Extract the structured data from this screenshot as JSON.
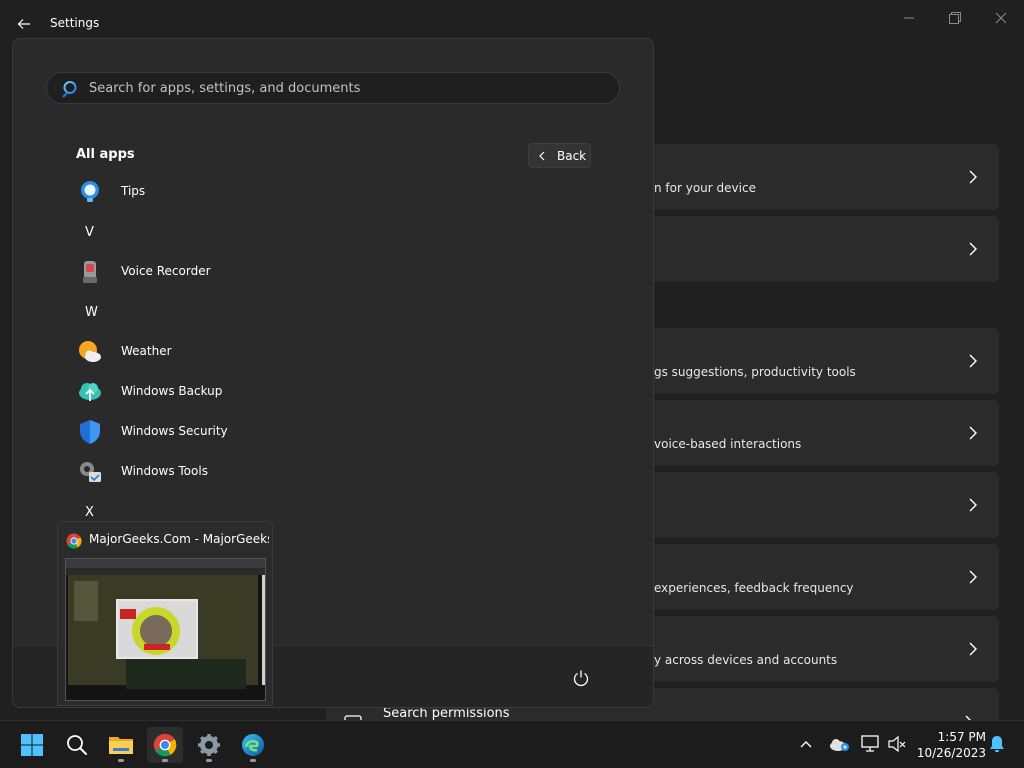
{
  "window": {
    "title": "Settings"
  },
  "settings_rows": [
    {
      "desc": "n for your device"
    },
    {
      "desc": ""
    },
    {
      "desc": "gs suggestions, productivity tools"
    },
    {
      "desc": "voice-based interactions"
    },
    {
      "desc": ""
    },
    {
      "desc": "experiences, feedback frequency"
    },
    {
      "desc": "y across devices and accounts"
    }
  ],
  "search_permissions": {
    "label": "Search permissions"
  },
  "start_menu": {
    "search": {
      "placeholder": "Search for apps, settings, and documents",
      "value": ""
    },
    "all_apps_title": "All apps",
    "back_label": "Back",
    "entries": [
      {
        "type": "app",
        "label": "Tips",
        "icon": "tips-icon"
      },
      {
        "type": "letter",
        "label": "V"
      },
      {
        "type": "app",
        "label": "Voice Recorder",
        "icon": "voice-recorder-icon"
      },
      {
        "type": "letter",
        "label": "W"
      },
      {
        "type": "app",
        "label": "Weather",
        "icon": "weather-icon"
      },
      {
        "type": "app",
        "label": "Windows Backup",
        "icon": "windows-backup-icon"
      },
      {
        "type": "app",
        "label": "Windows Security",
        "icon": "windows-security-icon"
      },
      {
        "type": "app",
        "label": "Windows Tools",
        "icon": "windows-tools-icon"
      },
      {
        "type": "letter",
        "label": "X"
      }
    ]
  },
  "preview": {
    "title": "MajorGeeks.Com - MajorGeeks ..."
  },
  "taskbar": {
    "apps": [
      "start-icon",
      "search-icon",
      "file-explorer-icon",
      "chrome-icon",
      "settings-icon",
      "edge-icon"
    ],
    "clock": {
      "time": "1:57 PM",
      "date": "10/26/2023"
    }
  },
  "colors": {
    "accent": "#3b82f6",
    "bg": "#202020",
    "panel": "#2a2a2a"
  }
}
